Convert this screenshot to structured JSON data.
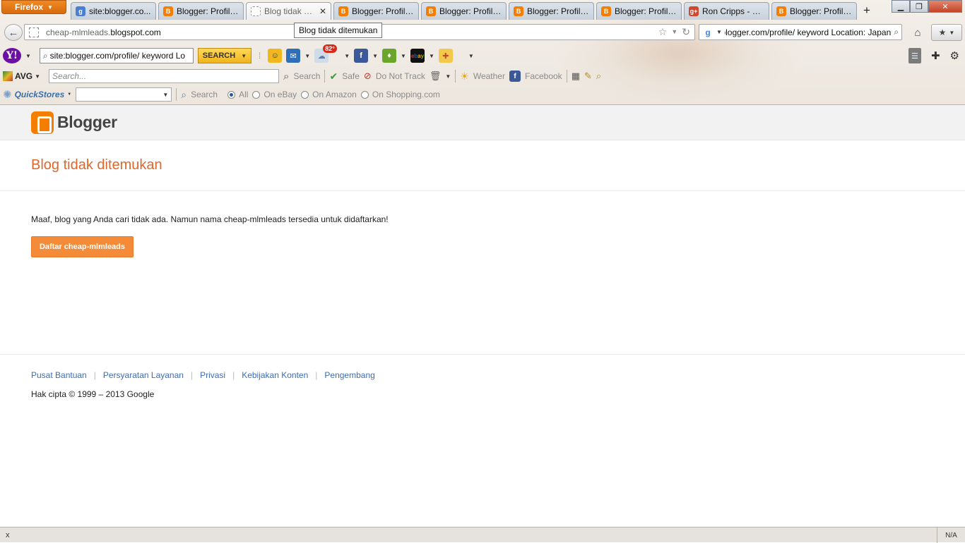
{
  "browser": {
    "app_button": "Firefox",
    "tabs": [
      {
        "label": "site:blogger.co...",
        "icon": "google-icon",
        "color": "#4a7fd4",
        "active": false
      },
      {
        "label": "Blogger: Profil U...",
        "icon": "blogger-icon",
        "color": "#f57d00",
        "active": false
      },
      {
        "label": "Blog tidak dit...",
        "icon": "dashed-page-icon",
        "color": "#ffffff",
        "active": true
      },
      {
        "label": "Blogger: Profil U...",
        "icon": "blogger-icon",
        "color": "#f57d00",
        "active": false
      },
      {
        "label": "Blogger: Profil U...",
        "icon": "blogger-icon",
        "color": "#f57d00",
        "active": false
      },
      {
        "label": "Blogger: Profil U...",
        "icon": "blogger-icon",
        "color": "#f57d00",
        "active": false
      },
      {
        "label": "Blogger: Profil U...",
        "icon": "blogger-icon",
        "color": "#f57d00",
        "active": false
      },
      {
        "label": "Ron Cripps - Go...",
        "icon": "google-plus-icon",
        "color": "#d2462b",
        "active": false
      },
      {
        "label": "Blogger: Profil U...",
        "icon": "blogger-icon",
        "color": "#f57d00",
        "active": false
      }
    ],
    "tooltip": "Blog tidak ditemukan",
    "url_prefix": "cheap-mlmleads.",
    "url_host": "blogspot.com",
    "search_value": "site:blogger.com/profile/ keyword Location: Japan",
    "newtab_label": "+"
  },
  "yahoo_toolbar": {
    "logo": "Y!",
    "search_value": "site:blogger.com/profile/ keyword Lo",
    "search_button": "SEARCH",
    "weather_badge": "82°"
  },
  "avg_toolbar": {
    "logo": "AVG",
    "search_placeholder": "Search...",
    "search_label": "Search",
    "safe_label": "Safe",
    "dnt_label": "Do Not Track",
    "weather_label": "Weather",
    "facebook_label": "Facebook"
  },
  "quickstores_toolbar": {
    "logo": "QuickStores",
    "search_label": "Search",
    "options": [
      "All",
      "On eBay",
      "On Amazon",
      "On Shopping.com"
    ],
    "selected": "All"
  },
  "page": {
    "brand": "Blogger",
    "title": "Blog tidak ditemukan",
    "message": "Maaf, blog yang Anda cari tidak ada. Namun nama cheap-mlmleads tersedia untuk didaftarkan!",
    "register_button": "Daftar cheap-mlmleads",
    "footer_links": [
      "Pusat Bantuan",
      "Persyaratan Layanan",
      "Privasi",
      "Kebijakan Konten",
      "Pengembang"
    ],
    "copyright": "Hak cipta © 1999 – 2013 Google"
  },
  "status": {
    "close_label": "x",
    "right_label": "N/A"
  },
  "colors": {
    "accent": "#e0672a",
    "button": "#f48b38",
    "link": "#3d6db4"
  }
}
